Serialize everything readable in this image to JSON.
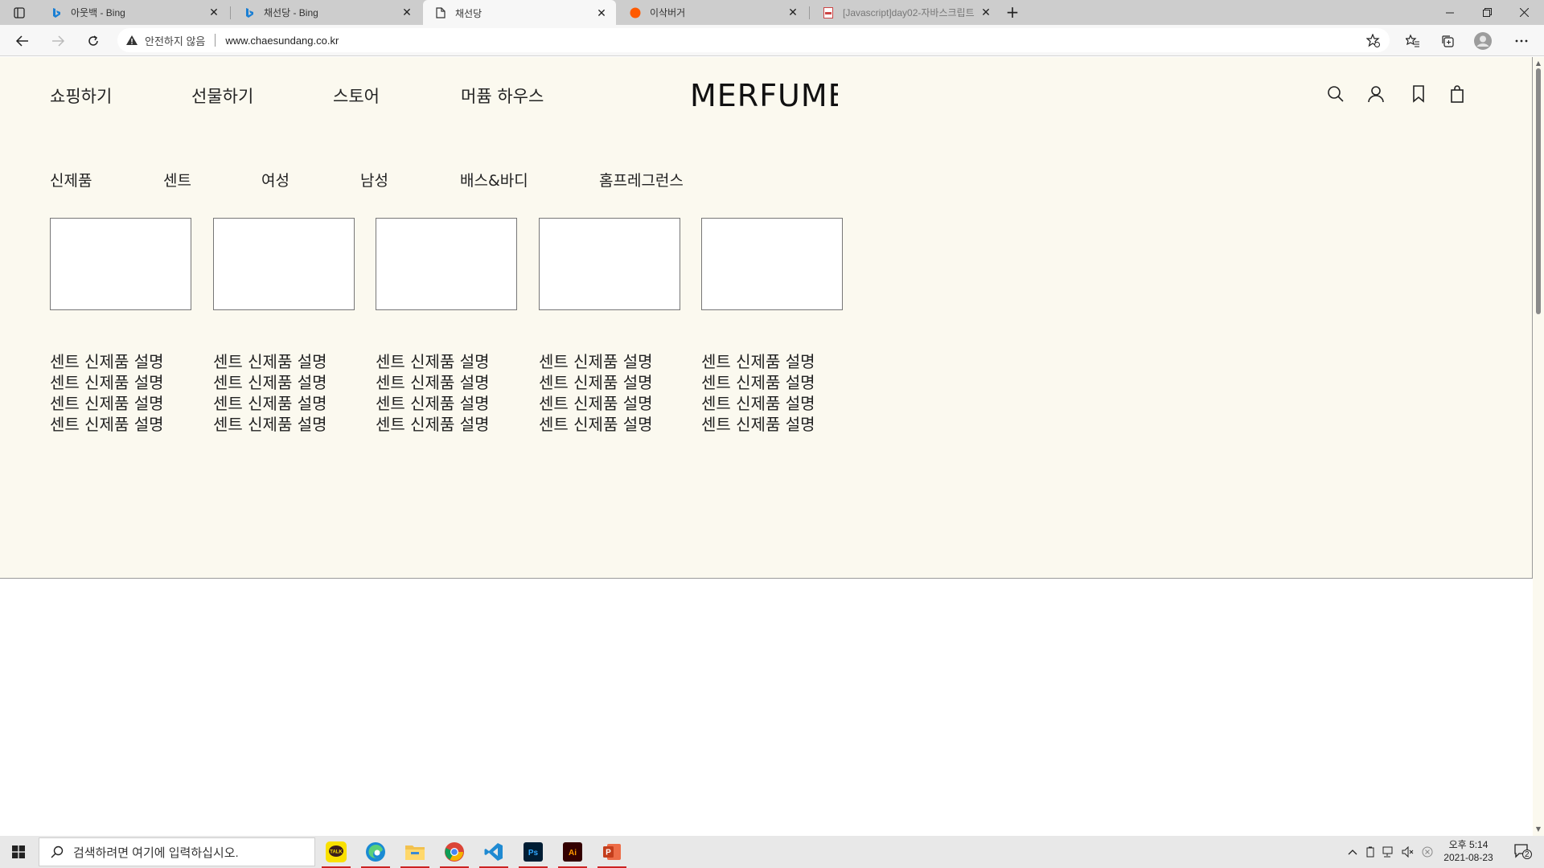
{
  "browser": {
    "tabs": [
      {
        "title": "아웃백 - Bing",
        "favicon": "bing-icon",
        "active": false
      },
      {
        "title": "채선당 - Bing",
        "favicon": "bing-icon",
        "active": false
      },
      {
        "title": "채선당",
        "favicon": "page-icon",
        "active": true
      },
      {
        "title": "이삭버거",
        "favicon": "orange-circle-icon",
        "active": false
      },
      {
        "title": "[Javascript]day02-자바스크립트",
        "favicon": "pdf-icon",
        "active": false
      }
    ],
    "security_label": "안전하지 않음",
    "url": "www.chaesundang.co.kr"
  },
  "site": {
    "main_nav": [
      "쇼핑하기",
      "선물하기",
      "스토어",
      "머퓸 하우스"
    ],
    "brand": "MERFUME",
    "header_icons": [
      "search-icon",
      "user-icon",
      "bookmark-icon",
      "shopping-bag-icon"
    ],
    "categories": [
      "신제품",
      "센트",
      "여성",
      "남성",
      "배스&바디",
      "홈프레그런스"
    ],
    "products": [
      {
        "lines": [
          "센트 신제품 설명",
          "센트 신제품 설명",
          "센트 신제품 설명",
          "센트 신제품 설명"
        ]
      },
      {
        "lines": [
          "센트 신제품 설명",
          "센트 신제품 설명",
          "센트 신제품 설명",
          "센트 신제품 설명"
        ]
      },
      {
        "lines": [
          "센트 신제품 설명",
          "센트 신제품 설명",
          "센트 신제품 설명",
          "센트 신제품 설명"
        ]
      },
      {
        "lines": [
          "센트 신제품 설명",
          "센트 신제품 설명",
          "센트 신제품 설명",
          "센트 신제품 설명"
        ]
      },
      {
        "lines": [
          "센트 신제품 설명",
          "센트 신제품 설명",
          "센트 신제품 설명",
          "센트 신제품 설명"
        ]
      }
    ],
    "colors": {
      "page_bg": "#fbf9ef",
      "text": "#222222"
    }
  },
  "taskbar": {
    "search_placeholder": "검색하려면 여기에 입력하십시오.",
    "apps": [
      "kakaotalk-icon",
      "edge-icon",
      "file-explorer-icon",
      "chrome-icon",
      "vscode-icon",
      "photoshop-icon",
      "illustrator-icon",
      "powerpoint-icon"
    ],
    "clock_time": "오후 5:14",
    "clock_date": "2021-08-23",
    "notification_count": "2"
  }
}
